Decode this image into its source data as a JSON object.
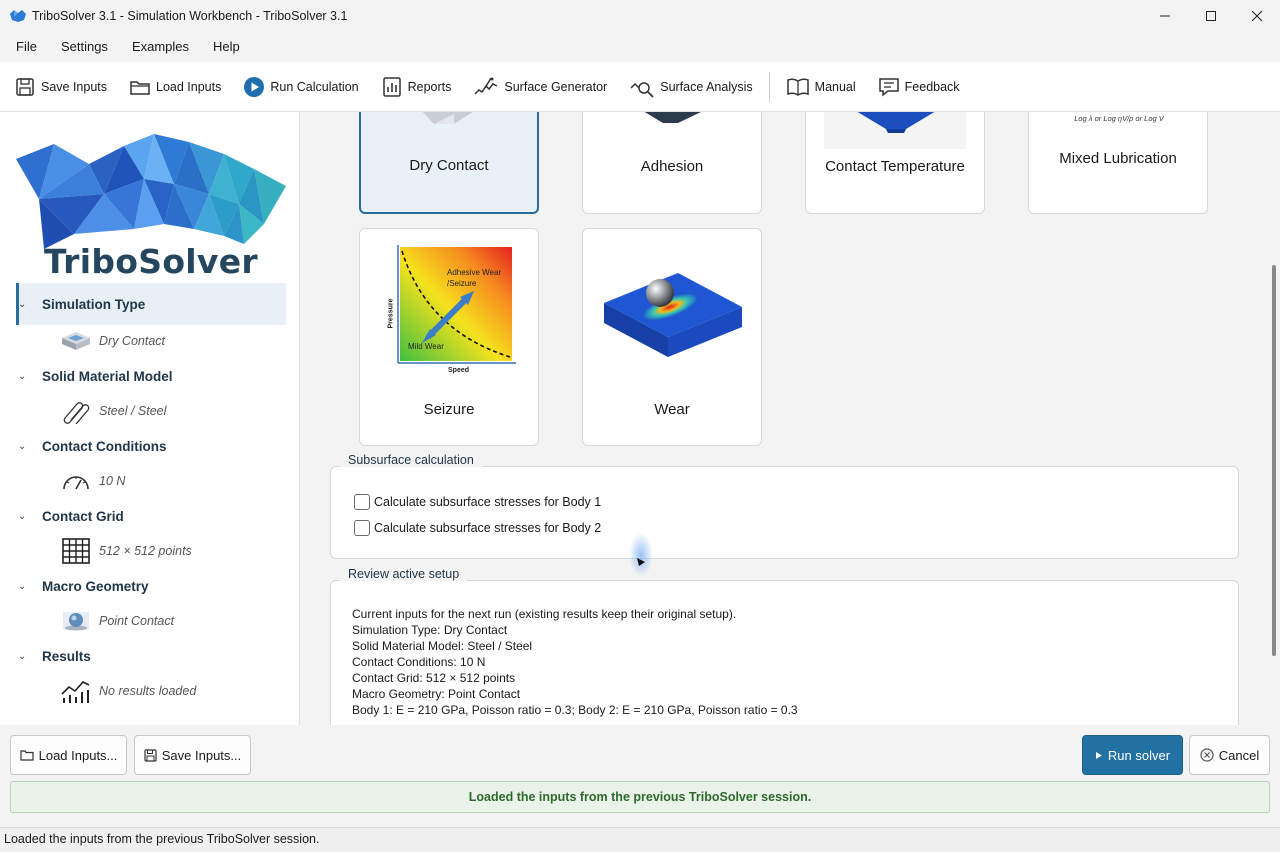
{
  "window": {
    "title": "TriboSolver 3.1 - Simulation Workbench - TriboSolver 3.1"
  },
  "menu": [
    "File",
    "Settings",
    "Examples",
    "Help"
  ],
  "toolbar": {
    "save_inputs": "Save Inputs",
    "load_inputs": "Load Inputs",
    "run_calculation": "Run Calculation",
    "reports": "Reports",
    "surface_generator": "Surface Generator",
    "surface_analysis": "Surface Analysis",
    "manual": "Manual",
    "feedback": "Feedback"
  },
  "sidebar": {
    "logo_text": "TriboSolver",
    "sections": [
      {
        "label": "Simulation Type",
        "value": "Dry Contact",
        "icon": "dry-contact-icon",
        "active": true
      },
      {
        "label": "Solid Material Model",
        "value": "Steel / Steel",
        "icon": "material-icon"
      },
      {
        "label": "Contact Conditions",
        "value": "10 N",
        "icon": "gauge-icon"
      },
      {
        "label": "Contact Grid",
        "value": "512 × 512 points",
        "icon": "grid-icon"
      },
      {
        "label": "Macro Geometry",
        "value": "Point Contact",
        "icon": "point-contact-icon"
      },
      {
        "label": "Results",
        "value": "No results loaded",
        "icon": "results-chart-icon"
      }
    ]
  },
  "simulation_types": [
    {
      "label": "Dry Contact",
      "selected": true
    },
    {
      "label": "Adhesion"
    },
    {
      "label": "Contact Temperature"
    },
    {
      "label": "Mixed Lubrication"
    },
    {
      "label": "Seizure"
    },
    {
      "label": "Wear"
    }
  ],
  "mixed_lubrication_axis": "Log λ or Log ηV/p  or Log V",
  "seizure_chart": {
    "ylabel": "Pressure",
    "xlabel": "Speed",
    "region_high": "Adhesive Wear /Seizure",
    "region_high_line1": "Adhesive Wear",
    "region_high_line2": "/Seizure",
    "region_low": "Mild Wear"
  },
  "subsurface": {
    "title": "Subsurface calculation",
    "options": [
      {
        "label": "Calculate subsurface stresses for Body 1",
        "checked": false
      },
      {
        "label": "Calculate subsurface stresses for Body 2",
        "checked": false
      }
    ]
  },
  "review": {
    "title": "Review active setup",
    "lines": [
      "Current inputs for the next run (existing results keep their original setup).",
      "Simulation Type: Dry Contact",
      "Solid Material Model: Steel / Steel",
      "Contact Conditions: 10 N",
      "Contact Grid: 512 × 512 points",
      "Macro Geometry: Point Contact",
      "Body 1: E = 210 GPa, Poisson ratio = 0.3; Body 2: E = 210 GPa, Poisson ratio = 0.3"
    ]
  },
  "buttons": {
    "load_inputs": "Load Inputs...",
    "save_inputs": "Save Inputs...",
    "run_solver": "Run solver",
    "cancel": "Cancel"
  },
  "banner": "Loaded the inputs from the previous TriboSolver session.",
  "status": "Loaded the inputs from the previous TriboSolver session.",
  "colors": {
    "accent": "#2271a3",
    "banner_bg": "#eaf3e9",
    "banner_text": "#2f6a2c"
  }
}
